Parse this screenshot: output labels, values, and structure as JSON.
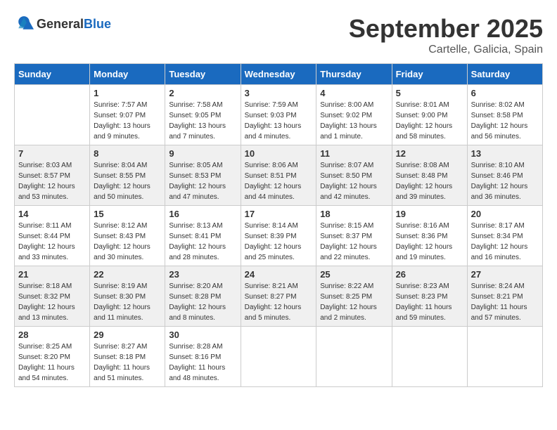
{
  "logo": {
    "text_general": "General",
    "text_blue": "Blue"
  },
  "title": {
    "month": "September 2025",
    "location": "Cartelle, Galicia, Spain"
  },
  "calendar": {
    "headers": [
      "Sunday",
      "Monday",
      "Tuesday",
      "Wednesday",
      "Thursday",
      "Friday",
      "Saturday"
    ],
    "rows": [
      [
        {
          "num": "",
          "sunrise": "",
          "sunset": "",
          "daylight": "",
          "empty": true
        },
        {
          "num": "1",
          "sunrise": "Sunrise: 7:57 AM",
          "sunset": "Sunset: 9:07 PM",
          "daylight": "Daylight: 13 hours and 9 minutes.",
          "empty": false
        },
        {
          "num": "2",
          "sunrise": "Sunrise: 7:58 AM",
          "sunset": "Sunset: 9:05 PM",
          "daylight": "Daylight: 13 hours and 7 minutes.",
          "empty": false
        },
        {
          "num": "3",
          "sunrise": "Sunrise: 7:59 AM",
          "sunset": "Sunset: 9:03 PM",
          "daylight": "Daylight: 13 hours and 4 minutes.",
          "empty": false
        },
        {
          "num": "4",
          "sunrise": "Sunrise: 8:00 AM",
          "sunset": "Sunset: 9:02 PM",
          "daylight": "Daylight: 13 hours and 1 minute.",
          "empty": false
        },
        {
          "num": "5",
          "sunrise": "Sunrise: 8:01 AM",
          "sunset": "Sunset: 9:00 PM",
          "daylight": "Daylight: 12 hours and 58 minutes.",
          "empty": false
        },
        {
          "num": "6",
          "sunrise": "Sunrise: 8:02 AM",
          "sunset": "Sunset: 8:58 PM",
          "daylight": "Daylight: 12 hours and 56 minutes.",
          "empty": false
        }
      ],
      [
        {
          "num": "7",
          "sunrise": "Sunrise: 8:03 AM",
          "sunset": "Sunset: 8:57 PM",
          "daylight": "Daylight: 12 hours and 53 minutes.",
          "empty": false
        },
        {
          "num": "8",
          "sunrise": "Sunrise: 8:04 AM",
          "sunset": "Sunset: 8:55 PM",
          "daylight": "Daylight: 12 hours and 50 minutes.",
          "empty": false
        },
        {
          "num": "9",
          "sunrise": "Sunrise: 8:05 AM",
          "sunset": "Sunset: 8:53 PM",
          "daylight": "Daylight: 12 hours and 47 minutes.",
          "empty": false
        },
        {
          "num": "10",
          "sunrise": "Sunrise: 8:06 AM",
          "sunset": "Sunset: 8:51 PM",
          "daylight": "Daylight: 12 hours and 44 minutes.",
          "empty": false
        },
        {
          "num": "11",
          "sunrise": "Sunrise: 8:07 AM",
          "sunset": "Sunset: 8:50 PM",
          "daylight": "Daylight: 12 hours and 42 minutes.",
          "empty": false
        },
        {
          "num": "12",
          "sunrise": "Sunrise: 8:08 AM",
          "sunset": "Sunset: 8:48 PM",
          "daylight": "Daylight: 12 hours and 39 minutes.",
          "empty": false
        },
        {
          "num": "13",
          "sunrise": "Sunrise: 8:10 AM",
          "sunset": "Sunset: 8:46 PM",
          "daylight": "Daylight: 12 hours and 36 minutes.",
          "empty": false
        }
      ],
      [
        {
          "num": "14",
          "sunrise": "Sunrise: 8:11 AM",
          "sunset": "Sunset: 8:44 PM",
          "daylight": "Daylight: 12 hours and 33 minutes.",
          "empty": false
        },
        {
          "num": "15",
          "sunrise": "Sunrise: 8:12 AM",
          "sunset": "Sunset: 8:43 PM",
          "daylight": "Daylight: 12 hours and 30 minutes.",
          "empty": false
        },
        {
          "num": "16",
          "sunrise": "Sunrise: 8:13 AM",
          "sunset": "Sunset: 8:41 PM",
          "daylight": "Daylight: 12 hours and 28 minutes.",
          "empty": false
        },
        {
          "num": "17",
          "sunrise": "Sunrise: 8:14 AM",
          "sunset": "Sunset: 8:39 PM",
          "daylight": "Daylight: 12 hours and 25 minutes.",
          "empty": false
        },
        {
          "num": "18",
          "sunrise": "Sunrise: 8:15 AM",
          "sunset": "Sunset: 8:37 PM",
          "daylight": "Daylight: 12 hours and 22 minutes.",
          "empty": false
        },
        {
          "num": "19",
          "sunrise": "Sunrise: 8:16 AM",
          "sunset": "Sunset: 8:36 PM",
          "daylight": "Daylight: 12 hours and 19 minutes.",
          "empty": false
        },
        {
          "num": "20",
          "sunrise": "Sunrise: 8:17 AM",
          "sunset": "Sunset: 8:34 PM",
          "daylight": "Daylight: 12 hours and 16 minutes.",
          "empty": false
        }
      ],
      [
        {
          "num": "21",
          "sunrise": "Sunrise: 8:18 AM",
          "sunset": "Sunset: 8:32 PM",
          "daylight": "Daylight: 12 hours and 13 minutes.",
          "empty": false
        },
        {
          "num": "22",
          "sunrise": "Sunrise: 8:19 AM",
          "sunset": "Sunset: 8:30 PM",
          "daylight": "Daylight: 12 hours and 11 minutes.",
          "empty": false
        },
        {
          "num": "23",
          "sunrise": "Sunrise: 8:20 AM",
          "sunset": "Sunset: 8:28 PM",
          "daylight": "Daylight: 12 hours and 8 minutes.",
          "empty": false
        },
        {
          "num": "24",
          "sunrise": "Sunrise: 8:21 AM",
          "sunset": "Sunset: 8:27 PM",
          "daylight": "Daylight: 12 hours and 5 minutes.",
          "empty": false
        },
        {
          "num": "25",
          "sunrise": "Sunrise: 8:22 AM",
          "sunset": "Sunset: 8:25 PM",
          "daylight": "Daylight: 12 hours and 2 minutes.",
          "empty": false
        },
        {
          "num": "26",
          "sunrise": "Sunrise: 8:23 AM",
          "sunset": "Sunset: 8:23 PM",
          "daylight": "Daylight: 11 hours and 59 minutes.",
          "empty": false
        },
        {
          "num": "27",
          "sunrise": "Sunrise: 8:24 AM",
          "sunset": "Sunset: 8:21 PM",
          "daylight": "Daylight: 11 hours and 57 minutes.",
          "empty": false
        }
      ],
      [
        {
          "num": "28",
          "sunrise": "Sunrise: 8:25 AM",
          "sunset": "Sunset: 8:20 PM",
          "daylight": "Daylight: 11 hours and 54 minutes.",
          "empty": false
        },
        {
          "num": "29",
          "sunrise": "Sunrise: 8:27 AM",
          "sunset": "Sunset: 8:18 PM",
          "daylight": "Daylight: 11 hours and 51 minutes.",
          "empty": false
        },
        {
          "num": "30",
          "sunrise": "Sunrise: 8:28 AM",
          "sunset": "Sunset: 8:16 PM",
          "daylight": "Daylight: 11 hours and 48 minutes.",
          "empty": false
        },
        {
          "num": "",
          "sunrise": "",
          "sunset": "",
          "daylight": "",
          "empty": true
        },
        {
          "num": "",
          "sunrise": "",
          "sunset": "",
          "daylight": "",
          "empty": true
        },
        {
          "num": "",
          "sunrise": "",
          "sunset": "",
          "daylight": "",
          "empty": true
        },
        {
          "num": "",
          "sunrise": "",
          "sunset": "",
          "daylight": "",
          "empty": true
        }
      ]
    ]
  }
}
